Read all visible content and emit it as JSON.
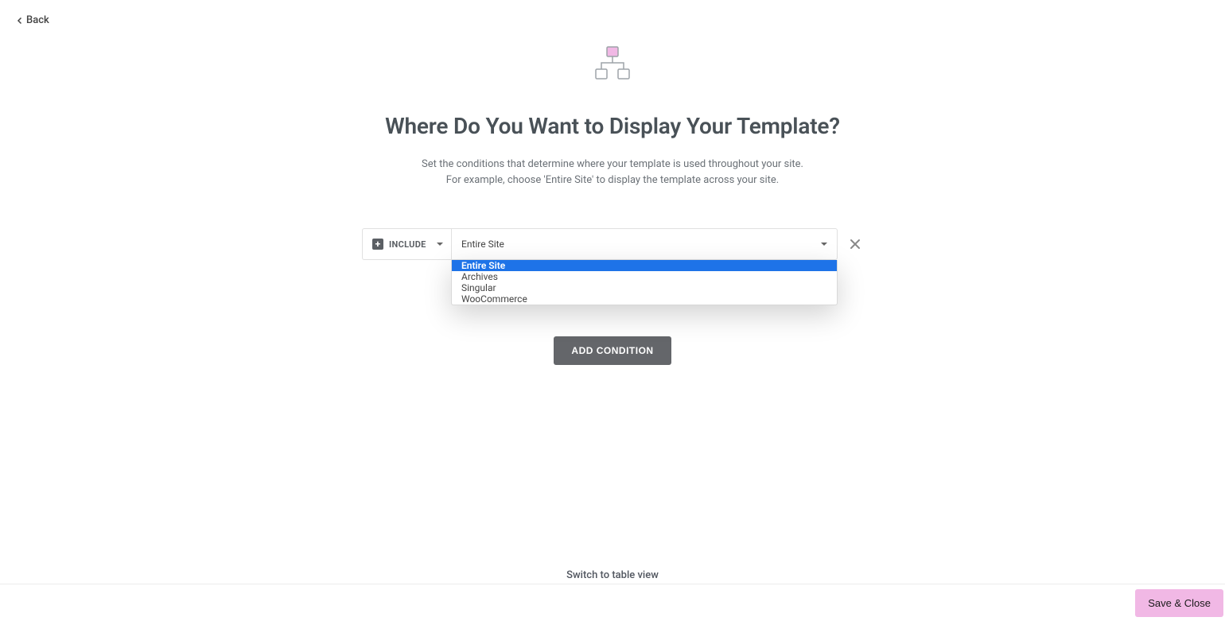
{
  "header": {
    "back_label": "Back"
  },
  "main": {
    "title": "Where Do You Want to Display Your Template?",
    "subtitle_line1": "Set the conditions that determine where your template is used throughout your site.",
    "subtitle_line2": "For example, choose 'Entire Site' to display the template across your site."
  },
  "condition": {
    "mode_label": "INCLUDE",
    "location_value": "Entire Site",
    "options": [
      "Entire Site",
      "Archives",
      "Singular",
      "WooCommerce"
    ]
  },
  "actions": {
    "add_condition_label": "ADD CONDITION",
    "switch_view_label": "Switch to table view",
    "save_close_label": "Save & Close"
  }
}
